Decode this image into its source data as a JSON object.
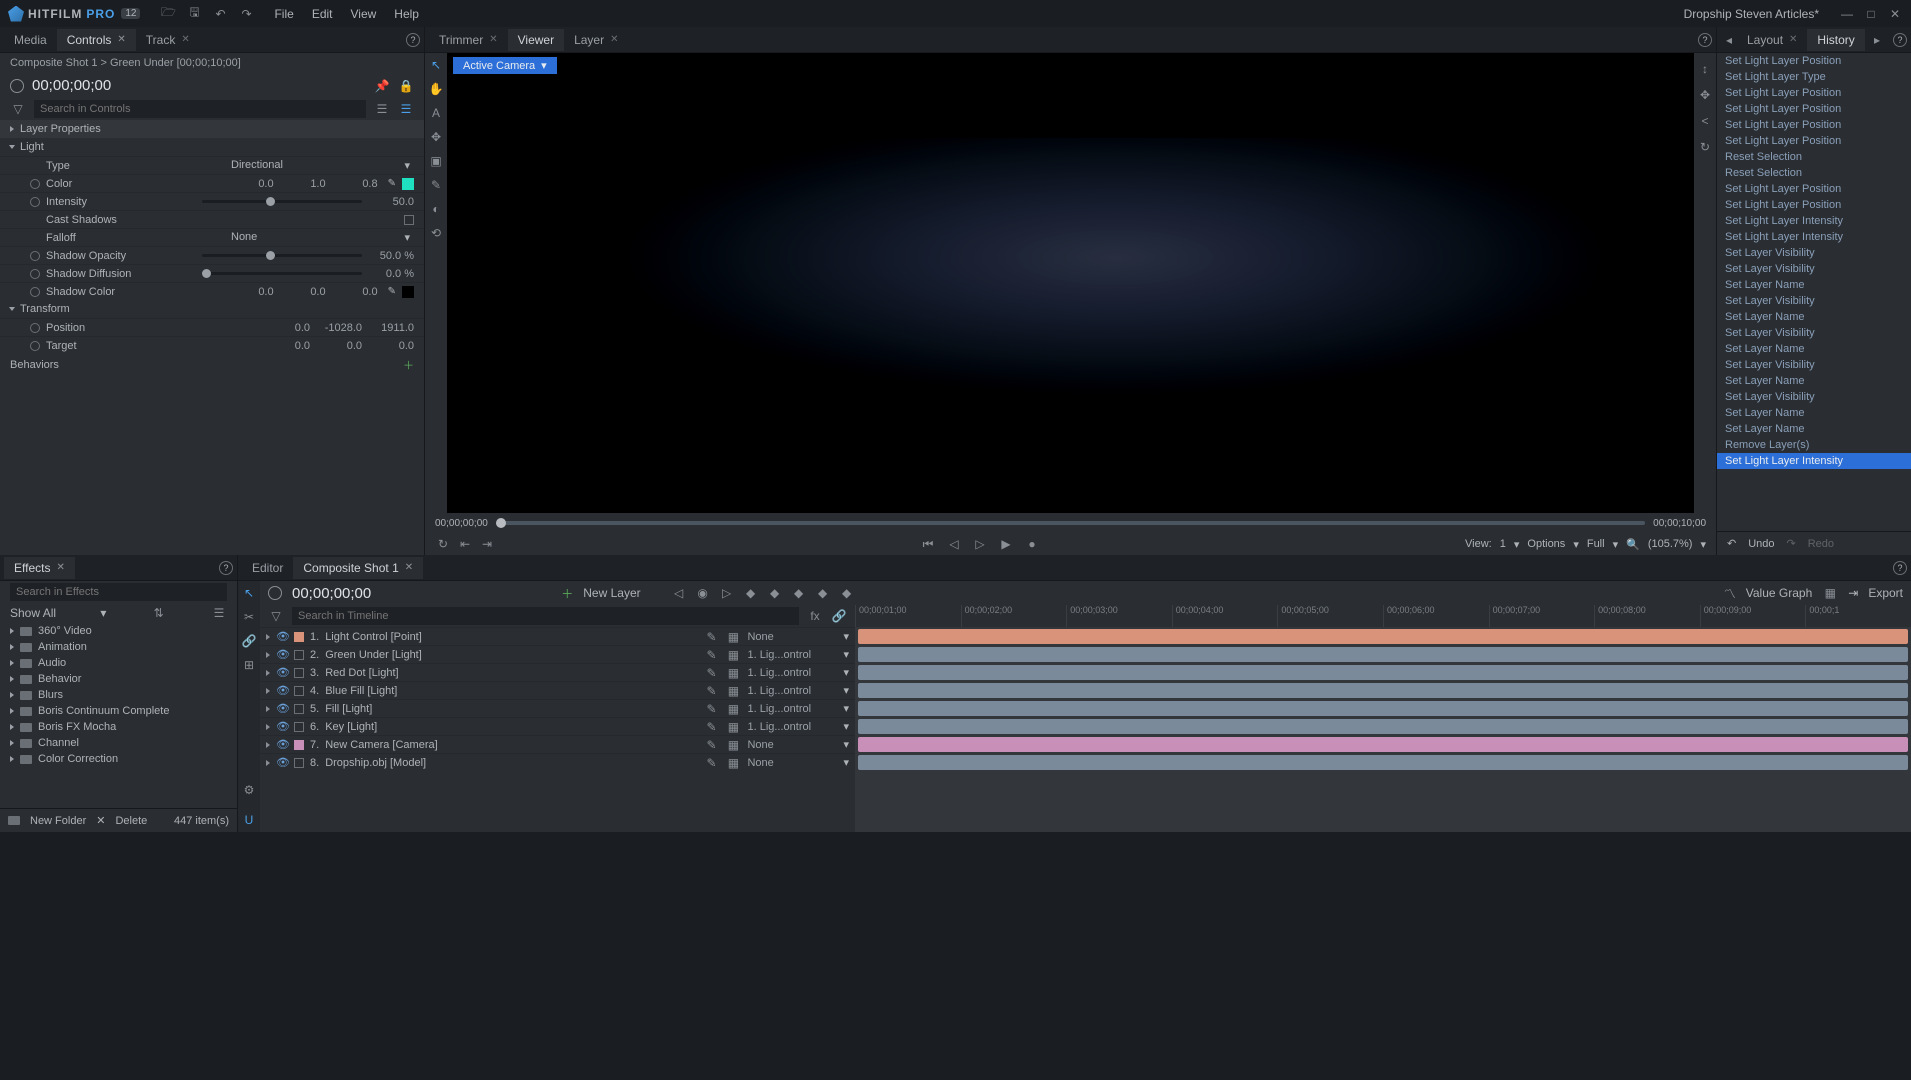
{
  "app": {
    "name": "HITFILM",
    "pro": "PRO",
    "badge": "12"
  },
  "menus": [
    "File",
    "Edit",
    "View",
    "Help"
  ],
  "project_title": "Dropship Steven Articles*",
  "left_tabs": [
    {
      "label": "Media",
      "closable": false,
      "active": false
    },
    {
      "label": "Controls",
      "closable": true,
      "active": true
    },
    {
      "label": "Track",
      "closable": true,
      "active": false
    }
  ],
  "breadcrumb": "Composite Shot 1 > Green Under [00;00;10;00]",
  "timecode": "00;00;00;00",
  "controls_search_placeholder": "Search in Controls",
  "controls": {
    "header_props": "Layer Properties",
    "header_light": "Light",
    "type_label": "Type",
    "type_value": "Directional",
    "color_label": "Color",
    "color_r": "0.0",
    "color_g": "1.0",
    "color_b": "0.8",
    "color_hex": "#1fe0c0",
    "intensity_label": "Intensity",
    "intensity_value": "50.0",
    "cast_label": "Cast Shadows",
    "falloff_label": "Falloff",
    "falloff_value": "None",
    "shadow_op_label": "Shadow Opacity",
    "shadow_op_value": "50.0 %",
    "shadow_diff_label": "Shadow Diffusion",
    "shadow_diff_value": "0.0 %",
    "shadow_color_label": "Shadow Color",
    "sc_r": "0.0",
    "sc_g": "0.0",
    "sc_b": "0.0",
    "sc_hex": "#000000",
    "header_transform": "Transform",
    "pos_label": "Position",
    "pos_x": "0.0",
    "pos_y": "-1028.0",
    "pos_z": "1911.0",
    "target_label": "Target",
    "target_x": "0.0",
    "target_y": "0.0",
    "target_z": "0.0",
    "header_behaviors": "Behaviors"
  },
  "center_tabs": [
    {
      "label": "Trimmer",
      "closable": true,
      "active": false
    },
    {
      "label": "Viewer",
      "closable": false,
      "active": true
    },
    {
      "label": "Layer",
      "closable": true,
      "active": false
    }
  ],
  "active_camera": "Active Camera",
  "playback": {
    "start": "00;00;00;00",
    "end": "00;00;10;00",
    "view_label": "View:",
    "view_value": "1",
    "options": "Options",
    "full": "Full",
    "zoom": "(105.7%)"
  },
  "right_tabs": [
    {
      "label": "Layout",
      "closable": true
    },
    {
      "label": "History",
      "closable": false
    }
  ],
  "history": [
    "Set Light Layer Position",
    "Set Light Layer Type",
    "Set Light Layer Position",
    "Set Light Layer Position",
    "Set Light Layer Position",
    "Set Light Layer Position",
    "Reset Selection",
    "Reset Selection",
    "Set Light Layer Position",
    "Set Light Layer Position",
    "Set Light Layer Intensity",
    "Set Light Layer Intensity",
    "Set Layer Visibility",
    "Set Layer Visibility",
    "Set Layer Name",
    "Set Layer Visibility",
    "Set Layer Name",
    "Set Layer Visibility",
    "Set Layer Name",
    "Set Layer Visibility",
    "Set Layer Name",
    "Set Layer Visibility",
    "Set Layer Name",
    "Set Layer Name",
    "Remove Layer(s)",
    "Set Light Layer Intensity"
  ],
  "history_selected_index": 25,
  "history_footer": {
    "undo": "Undo",
    "redo": "Redo"
  },
  "effects_tab": "Effects",
  "effects_search_placeholder": "Search in Effects",
  "effects_showall": "Show All",
  "effects_folders": [
    "360° Video",
    "Animation",
    "Audio",
    "Behavior",
    "Blurs",
    "Boris Continuum Complete",
    "Boris FX Mocha",
    "Channel",
    "Color Correction"
  ],
  "effects_footer": {
    "new_folder": "New Folder",
    "delete": "Delete",
    "count": "447 item(s)"
  },
  "timeline_tabs": [
    {
      "label": "Editor",
      "active": false,
      "closable": false
    },
    {
      "label": "Composite Shot 1",
      "active": true,
      "closable": true
    }
  ],
  "tl_top": {
    "timecode": "00;00;00;00",
    "new_layer": "New Layer",
    "value_graph": "Value Graph",
    "export": "Export"
  },
  "tl_search_placeholder": "Search in Timeline",
  "tl_ruler": [
    "00;00;01;00",
    "00;00;02;00",
    "00;00;03;00",
    "00;00;04;00",
    "00;00;05;00",
    "00;00;06;00",
    "00;00;07;00",
    "00;00;08;00",
    "00;00;09;00",
    "00;00;1"
  ],
  "layers": [
    {
      "n": "1.",
      "name": "Light Control [Point]",
      "parent": "None",
      "color": "#d8937a",
      "sq": "#d8937a"
    },
    {
      "n": "2.",
      "name": "Green Under [Light]",
      "parent": "1. Lig...ontrol",
      "color": "#7a8a9a",
      "sq": ""
    },
    {
      "n": "3.",
      "name": "Red Dot [Light]",
      "parent": "1. Lig...ontrol",
      "color": "#7a8a9a",
      "sq": ""
    },
    {
      "n": "4.",
      "name": "Blue Fill [Light]",
      "parent": "1. Lig...ontrol",
      "color": "#7a8a9a",
      "sq": ""
    },
    {
      "n": "5.",
      "name": "Fill [Light]",
      "parent": "1. Lig...ontrol",
      "color": "#7a8a9a",
      "sq": ""
    },
    {
      "n": "6.",
      "name": "Key [Light]",
      "parent": "1. Lig...ontrol",
      "color": "#7a8a9a",
      "sq": ""
    },
    {
      "n": "7.",
      "name": "New Camera [Camera]",
      "parent": "None",
      "color": "#c890b8",
      "sq": "#c890b8"
    },
    {
      "n": "8.",
      "name": "Dropship.obj [Model]",
      "parent": "None",
      "color": "#7a8a9a",
      "sq": ""
    }
  ]
}
